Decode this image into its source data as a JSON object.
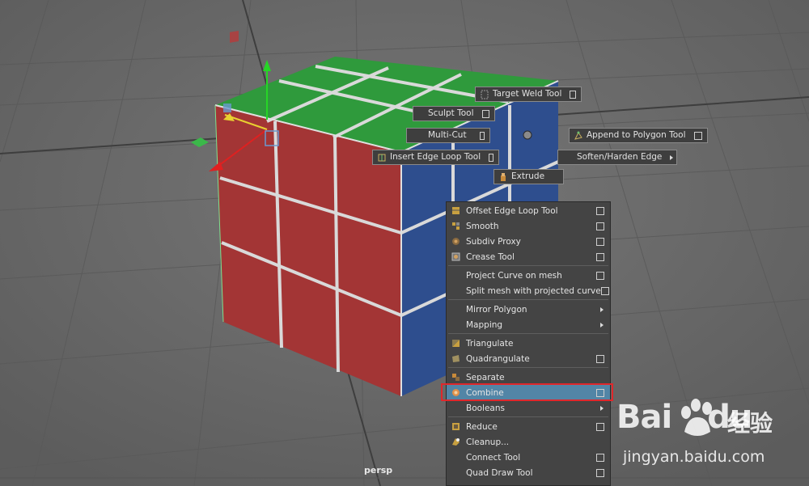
{
  "viewport": {
    "camera": "persp"
  },
  "marking_menu": [
    {
      "id": "target-weld",
      "label": "Target Weld Tool",
      "icon": "weld-icon",
      "has_option_box": true
    },
    {
      "id": "sculpt",
      "label": "Sculpt Tool",
      "icon": null,
      "has_option_box": true
    },
    {
      "id": "multi-cut",
      "label": "Multi-Cut",
      "icon": null,
      "has_option_box": true
    },
    {
      "id": "append-polygon",
      "label": "Append to Polygon Tool",
      "icon": "append-polygon-icon",
      "has_option_box": true
    },
    {
      "id": "insert-edge-loop",
      "label": "Insert Edge Loop Tool",
      "icon": "edge-loop-icon",
      "has_option_box": true
    },
    {
      "id": "soften-harden",
      "label": "Soften/Harden Edge",
      "icon": null,
      "has_submenu": true
    },
    {
      "id": "extrude",
      "label": "Extrude",
      "icon": "extrude-icon",
      "has_option_box": false
    }
  ],
  "context_menu": {
    "items": [
      {
        "label": "Offset Edge Loop Tool",
        "icon": "offset-edge-loop-icon",
        "option_box": true
      },
      {
        "label": "Smooth",
        "icon": "smooth-icon",
        "option_box": true
      },
      {
        "label": "Subdiv Proxy",
        "icon": "subdiv-proxy-icon",
        "option_box": true
      },
      {
        "label": "Crease Tool",
        "icon": "crease-tool-icon",
        "option_box": true
      },
      {
        "label": "Project Curve on mesh",
        "icon": null,
        "option_box": true
      },
      {
        "label": "Split mesh with projected curve",
        "icon": null,
        "option_box": true
      },
      {
        "label": "Mirror Polygon",
        "icon": null,
        "submenu": true
      },
      {
        "label": "Mapping",
        "icon": null,
        "submenu": true
      },
      {
        "label": "Triangulate",
        "icon": "triangulate-icon",
        "option_box": false
      },
      {
        "label": "Quadrangulate",
        "icon": "quadrangulate-icon",
        "option_box": true
      },
      {
        "label": "Separate",
        "icon": "separate-icon",
        "option_box": false
      },
      {
        "label": "Combine",
        "icon": "combine-icon",
        "option_box": true,
        "highlighted": true
      },
      {
        "label": "Booleans",
        "icon": null,
        "submenu": true
      },
      {
        "label": "Reduce",
        "icon": "reduce-icon",
        "option_box": true
      },
      {
        "label": "Cleanup...",
        "icon": "cleanup-icon",
        "option_box": false
      },
      {
        "label": "Connect Tool",
        "icon": null,
        "option_box": true
      },
      {
        "label": "Quad Draw Tool",
        "icon": null,
        "option_box": true
      }
    ]
  },
  "watermark": {
    "logo_text_1": "Bai",
    "logo_text_2": "du",
    "cn_text": "经验",
    "url": "jingyan.baidu.com"
  },
  "colors": {
    "highlight": "#5285a6",
    "red_box": "#e0272b",
    "cube_red": "#a33535",
    "cube_green": "#2f9a3c",
    "cube_blue": "#2e4e8e"
  }
}
